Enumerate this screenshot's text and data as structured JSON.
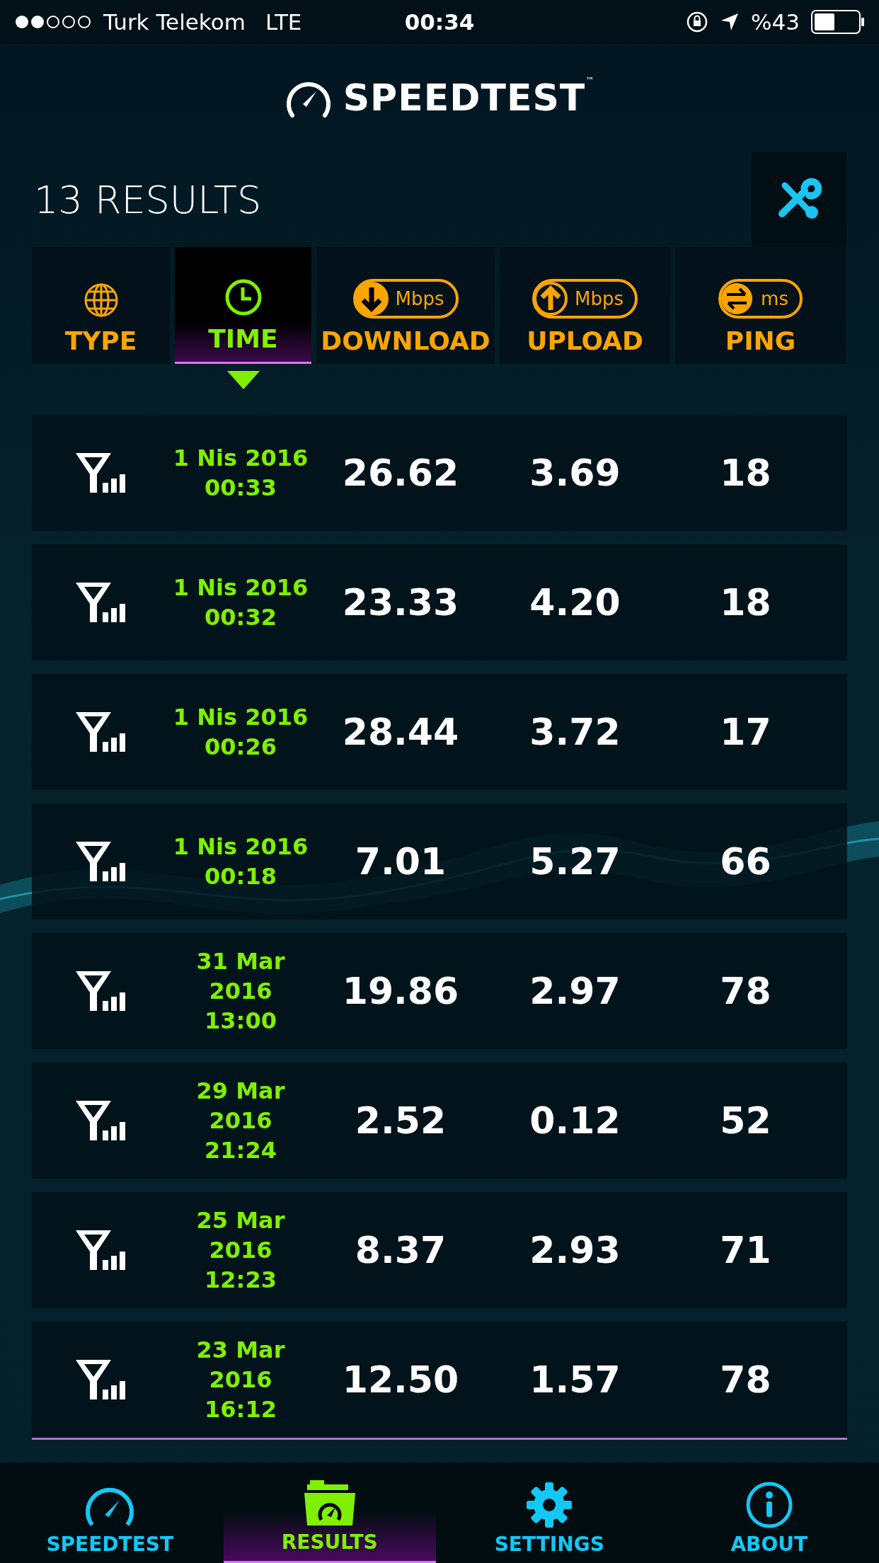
{
  "status_bar": {
    "carrier": "Turk Telekom",
    "network": "LTE",
    "time": "00:34",
    "battery": "%43"
  },
  "app_title": "SPEEDTEST",
  "trademark": "™",
  "results_count": "13 RESULTS",
  "columns": [
    {
      "kind": "type",
      "label": "TYPE",
      "selected": false
    },
    {
      "kind": "time",
      "label": "TIME",
      "selected": true
    },
    {
      "kind": "download",
      "label": "DOWNLOAD",
      "unit": "Mbps",
      "selected": false
    },
    {
      "kind": "upload",
      "label": "UPLOAD",
      "unit": "Mbps",
      "selected": false
    },
    {
      "kind": "ping",
      "label": "PING",
      "unit": "ms",
      "selected": false
    }
  ],
  "rows": [
    {
      "time": [
        "1 Nis 2016",
        "00:33"
      ],
      "download": "26.62",
      "upload": "3.69",
      "ping": "18"
    },
    {
      "time": [
        "1 Nis 2016",
        "00:32"
      ],
      "download": "23.33",
      "upload": "4.20",
      "ping": "18"
    },
    {
      "time": [
        "1 Nis 2016",
        "00:26"
      ],
      "download": "28.44",
      "upload": "3.72",
      "ping": "17"
    },
    {
      "time": [
        "1 Nis 2016",
        "00:18"
      ],
      "download": "7.01",
      "upload": "5.27",
      "ping": "66"
    },
    {
      "time": [
        "31 Mar",
        "2016",
        "13:00"
      ],
      "download": "19.86",
      "upload": "2.97",
      "ping": "78"
    },
    {
      "time": [
        "29 Mar",
        "2016",
        "21:24"
      ],
      "download": "2.52",
      "upload": "0.12",
      "ping": "52"
    },
    {
      "time": [
        "25 Mar",
        "2016",
        "12:23"
      ],
      "download": "8.37",
      "upload": "2.93",
      "ping": "71"
    },
    {
      "time": [
        "23 Mar",
        "2016",
        "16:12"
      ],
      "download": "12.50",
      "upload": "1.57",
      "ping": "78"
    }
  ],
  "tabs": [
    {
      "kind": "speedtest",
      "label": "SPEEDTEST",
      "selected": false
    },
    {
      "kind": "results",
      "label": "RESULTS",
      "selected": true
    },
    {
      "kind": "settings",
      "label": "SETTINGS",
      "selected": false
    },
    {
      "kind": "about",
      "label": "ABOUT",
      "selected": false
    }
  ]
}
